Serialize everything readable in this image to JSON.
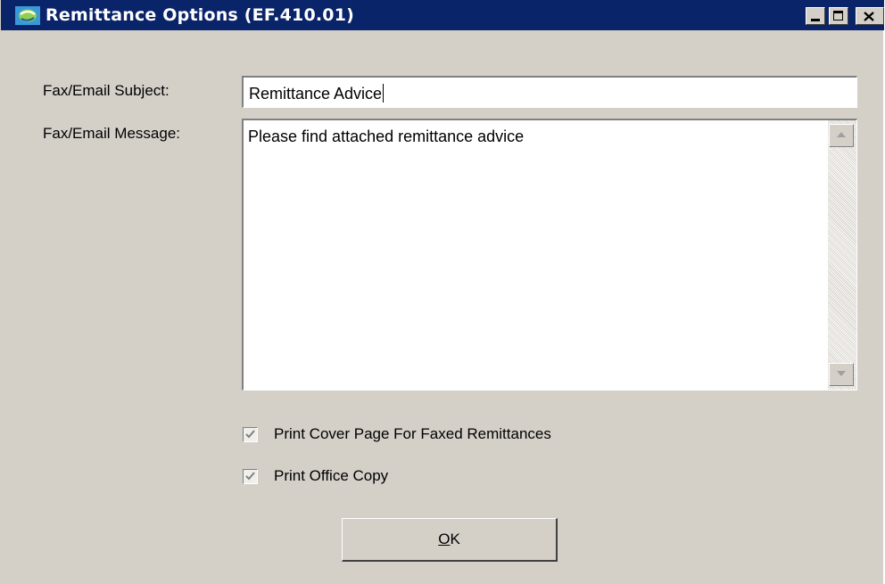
{
  "window": {
    "title": "Remittance Options (EF.410.01)",
    "title_bar_color": "#0a246a",
    "app_icon": "app-globe-icon",
    "controls": {
      "minimize_icon": "minimize-icon",
      "maximize_icon": "maximize-icon",
      "close_icon": "close-icon"
    }
  },
  "form": {
    "subject": {
      "label": "Fax/Email Subject:",
      "value": "Remittance Advice"
    },
    "message": {
      "label": "Fax/Email Message:",
      "value": "Please find attached remittance advice",
      "scroll_up_icon": "scroll-up-arrow-icon",
      "scroll_down_icon": "scroll-down-arrow-icon"
    },
    "options": [
      {
        "label": "Print Cover Page For Faxed Remittances",
        "checked": true,
        "enabled": false
      },
      {
        "label": "Print Office Copy",
        "checked": true,
        "enabled": false
      }
    ],
    "ok_button": {
      "mnemonic": "O",
      "rest": "K"
    }
  }
}
